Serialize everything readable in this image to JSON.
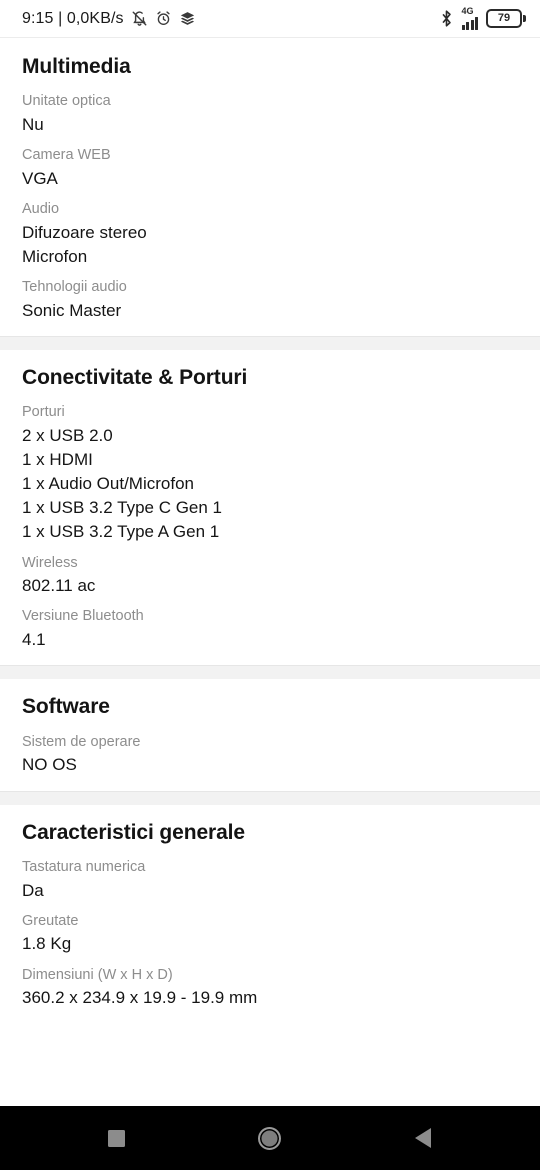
{
  "status_bar": {
    "clock_and_net": "9:15 | 0,0KB/s",
    "icons": [
      "bell-muted-icon",
      "alarm-clock-icon",
      "layers-icon"
    ],
    "bluetooth": "bluetooth-icon",
    "network_type": "4G",
    "signal_bars": 4,
    "battery_percent": "79"
  },
  "sections": [
    {
      "title": "Multimedia",
      "rows": [
        {
          "label": "Unitate optica",
          "value": "Nu"
        },
        {
          "label": "Camera WEB",
          "value": "VGA"
        },
        {
          "label": "Audio",
          "value": "Difuzoare stereo\nMicrofon"
        },
        {
          "label": "Tehnologii audio",
          "value": "Sonic Master"
        }
      ]
    },
    {
      "title": "Conectivitate & Porturi",
      "rows": [
        {
          "label": "Porturi",
          "value": "2 x USB 2.0\n1 x HDMI\n1 x Audio Out/Microfon\n1 x USB 3.2 Type C Gen 1\n1 x USB 3.2 Type A Gen 1"
        },
        {
          "label": "Wireless",
          "value": "802.11 ac"
        },
        {
          "label": "Versiune Bluetooth",
          "value": "4.1"
        }
      ]
    },
    {
      "title": "Software",
      "rows": [
        {
          "label": "Sistem de operare",
          "value": "NO OS"
        }
      ]
    },
    {
      "title": "Caracteristici generale",
      "rows": [
        {
          "label": "Tastatura numerica",
          "value": "Da"
        },
        {
          "label": "Greutate",
          "value": "1.8 Kg"
        },
        {
          "label": "Dimensiuni (W x H x D)",
          "value": "360.2 x 234.9 x 19.9 - 19.9 mm"
        }
      ]
    }
  ],
  "nav_bar": {
    "recents_label": "recent-apps",
    "home_label": "home",
    "back_label": "back"
  },
  "colors": {
    "background": "#ffffff",
    "band": "#f2f2f2",
    "label": "#8d8d8d",
    "value": "#151515",
    "nav_background": "#000000",
    "nav_icon": "#8c8c8c"
  }
}
